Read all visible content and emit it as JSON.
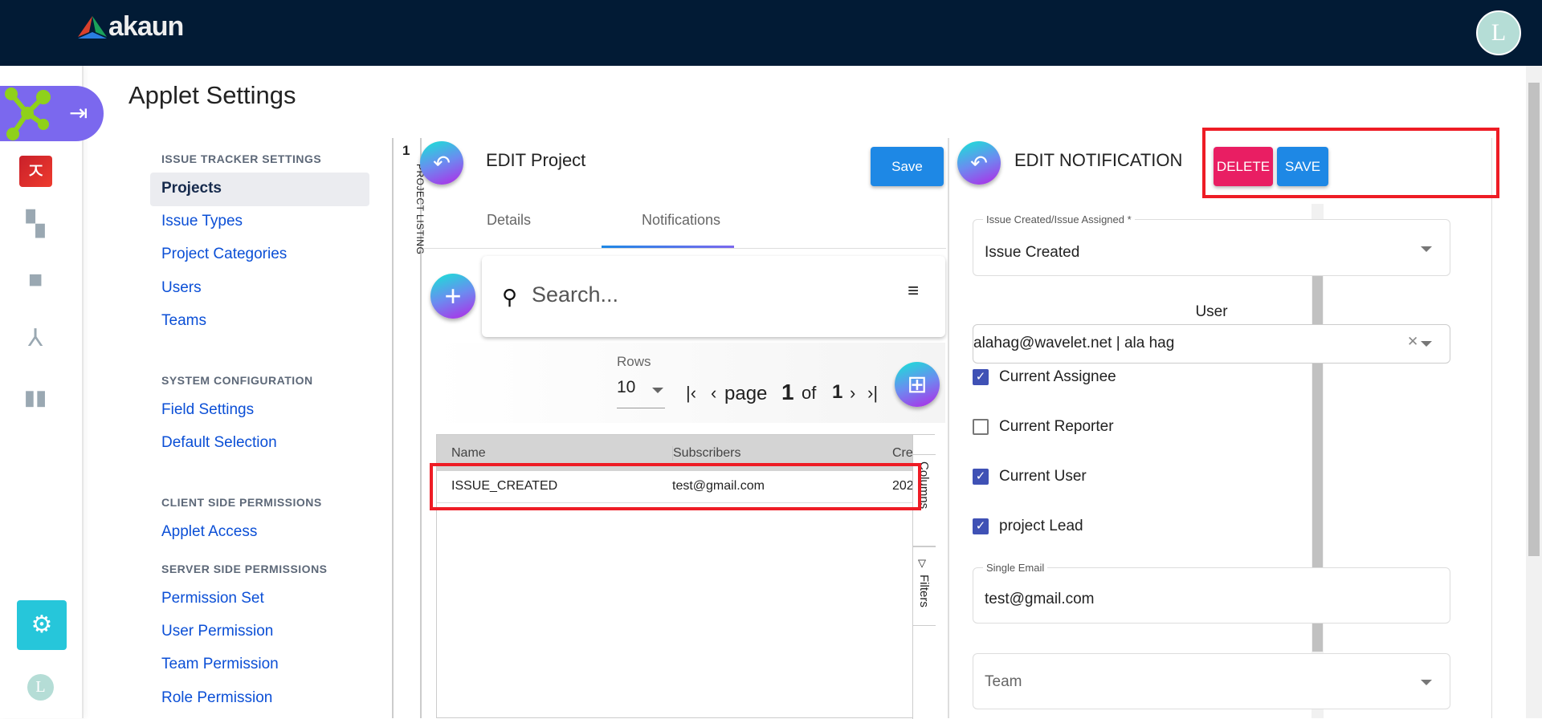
{
  "header": {
    "logo_text": "akaun",
    "avatar_letter": "L"
  },
  "page": {
    "title": "Applet Settings"
  },
  "settings_nav": {
    "sections": [
      {
        "heading": "ISSUE TRACKER SETTINGS",
        "items": [
          "Projects",
          "Issue Types",
          "Project Categories",
          "Users",
          "Teams"
        ]
      },
      {
        "heading": "SYSTEM CONFIGURATION",
        "items": [
          "Field Settings",
          "Default Selection"
        ]
      },
      {
        "heading": "CLIENT SIDE PERMISSIONS",
        "items": [
          "Applet Access"
        ]
      },
      {
        "heading": "SERVER SIDE PERMISSIONS",
        "items": [
          "Permission Set",
          "User Permission",
          "Team Permission",
          "Role Permission"
        ]
      }
    ],
    "active": "Projects"
  },
  "listing_strip": {
    "count": "1",
    "label": "PROJECT LISTING"
  },
  "edit_project": {
    "title": "EDIT Project",
    "save_label": "Save",
    "tabs": [
      "Details",
      "Notifications"
    ],
    "active_tab": "Notifications",
    "search_placeholder": "Search...",
    "rows_label": "Rows",
    "rows_value": "10",
    "page_word": "page",
    "page_current": "1",
    "page_of": "of",
    "page_total": "1",
    "table": {
      "columns": [
        "Name",
        "Subscribers",
        "Cre"
      ],
      "rows": [
        [
          "ISSUE_CREATED",
          "test@gmail.com",
          "202"
        ]
      ]
    },
    "side_tabs": [
      "Columns",
      "Filters"
    ]
  },
  "edit_notification": {
    "title": "EDIT NOTIFICATION",
    "delete_label": "DELETE",
    "save_label": "SAVE",
    "event_label": "Issue Created/Issue Assigned *",
    "event_value": "Issue Created",
    "user_heading": "User",
    "user_value": "alahag@wavelet.net | ala hag",
    "checkboxes": [
      {
        "label": "Current Assignee",
        "checked": true
      },
      {
        "label": "Current Reporter",
        "checked": false
      },
      {
        "label": "Current User",
        "checked": true
      },
      {
        "label": "project Lead",
        "checked": true
      }
    ],
    "single_email_label": "Single Email",
    "single_email_value": "test@gmail.com",
    "team_placeholder": "Team"
  },
  "colors": {
    "topbar": "#021b35",
    "save": "#1e88e5",
    "delete": "#e91e63",
    "checkbox": "#3f51b5",
    "link": "#0b4fd6",
    "highlight": "#ee1c25"
  }
}
